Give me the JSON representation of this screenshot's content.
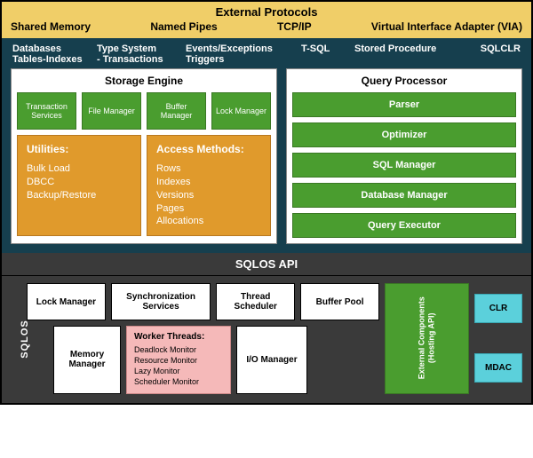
{
  "protocols": {
    "title": "External Protocols",
    "items": [
      "Shared Memory",
      "Named Pipes",
      "TCP/IP",
      "Virtual Interface Adapter (VIA)"
    ]
  },
  "main_labels": {
    "col1a": "Databases",
    "col1b": "Tables-Indexes",
    "col2a": "Type System",
    "col2b": "- Transactions",
    "col3a": "Events/Exceptions",
    "col3b": "Triggers",
    "col4": "T-SQL",
    "col5": "Stored Procedure",
    "col6": "SQLCLR"
  },
  "storage": {
    "title": "Storage Engine",
    "green": [
      "Transaction Services",
      "File Manager",
      "Buffer Manager",
      "Lock Manager"
    ],
    "utilities": {
      "title": "Utilities:",
      "items": [
        "Bulk Load",
        "DBCC",
        "Backup/Restore"
      ]
    },
    "access": {
      "title": "Access Methods:",
      "items": [
        "Rows",
        "Indexes",
        "Versions",
        "Pages",
        "Allocations"
      ]
    }
  },
  "query": {
    "title": "Query Processor",
    "bars": [
      "Parser",
      "Optimizer",
      "SQL Manager",
      "Database Manager",
      "Query Executor"
    ]
  },
  "sqlos_api": "SQLOS API",
  "sqlos_label": "SQLOS",
  "bottom": {
    "row1": [
      "Lock Manager",
      "Synchronization Services",
      "Thread Scheduler",
      "Buffer Pool"
    ],
    "mem": "Memory Manager",
    "worker": {
      "title": "Worker Threads:",
      "items": [
        "Deadlock Monitor",
        "Resource Monitor",
        "Lazy Monitor",
        "Scheduler Monitor"
      ]
    },
    "io": "I/O Manager",
    "ext_line1": "External Components",
    "ext_line2": "(Hosting API)",
    "side": [
      "CLR",
      "MDAC"
    ]
  }
}
